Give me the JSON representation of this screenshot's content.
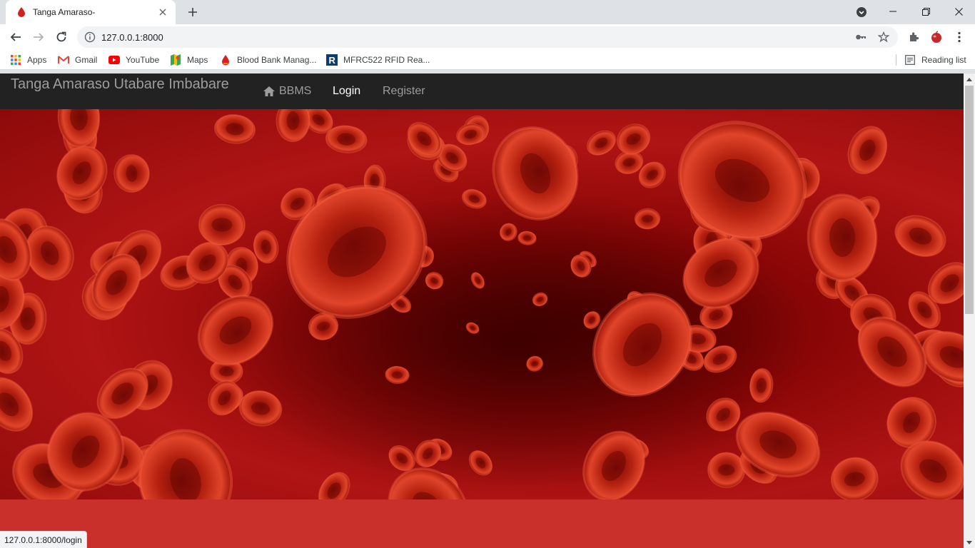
{
  "browser": {
    "tab": {
      "title": "Tanga Amaraso-",
      "favicon": "blood-drop-icon"
    },
    "address": {
      "url": "127.0.0.1:8000"
    },
    "bookmarks": [
      {
        "label": "Apps",
        "icon": "apps-grid-icon"
      },
      {
        "label": "Gmail",
        "icon": "gmail-icon"
      },
      {
        "label": "YouTube",
        "icon": "youtube-icon"
      },
      {
        "label": "Maps",
        "icon": "maps-icon"
      },
      {
        "label": "Blood Bank Manag...",
        "icon": "blood-drop-icon"
      },
      {
        "label": "MFRC522 RFID Rea...",
        "icon": "r-letter-icon"
      }
    ],
    "reading_list": "Reading list",
    "status_url": "127.0.0.1:8000/login"
  },
  "page": {
    "brand": "Tanga Amaraso Utabare Imbabare",
    "nav": [
      {
        "label": "BBMS",
        "icon": "home-icon",
        "active": false
      },
      {
        "label": "Login",
        "active": true
      },
      {
        "label": "Register",
        "active": false
      }
    ],
    "hero_image": "red-blood-cells-image"
  },
  "colors": {
    "navbar": "#222222",
    "nav_text": "#9d9d9d",
    "nav_active": "#ffffff",
    "band": "#c9302c",
    "blood": "#b01414"
  }
}
